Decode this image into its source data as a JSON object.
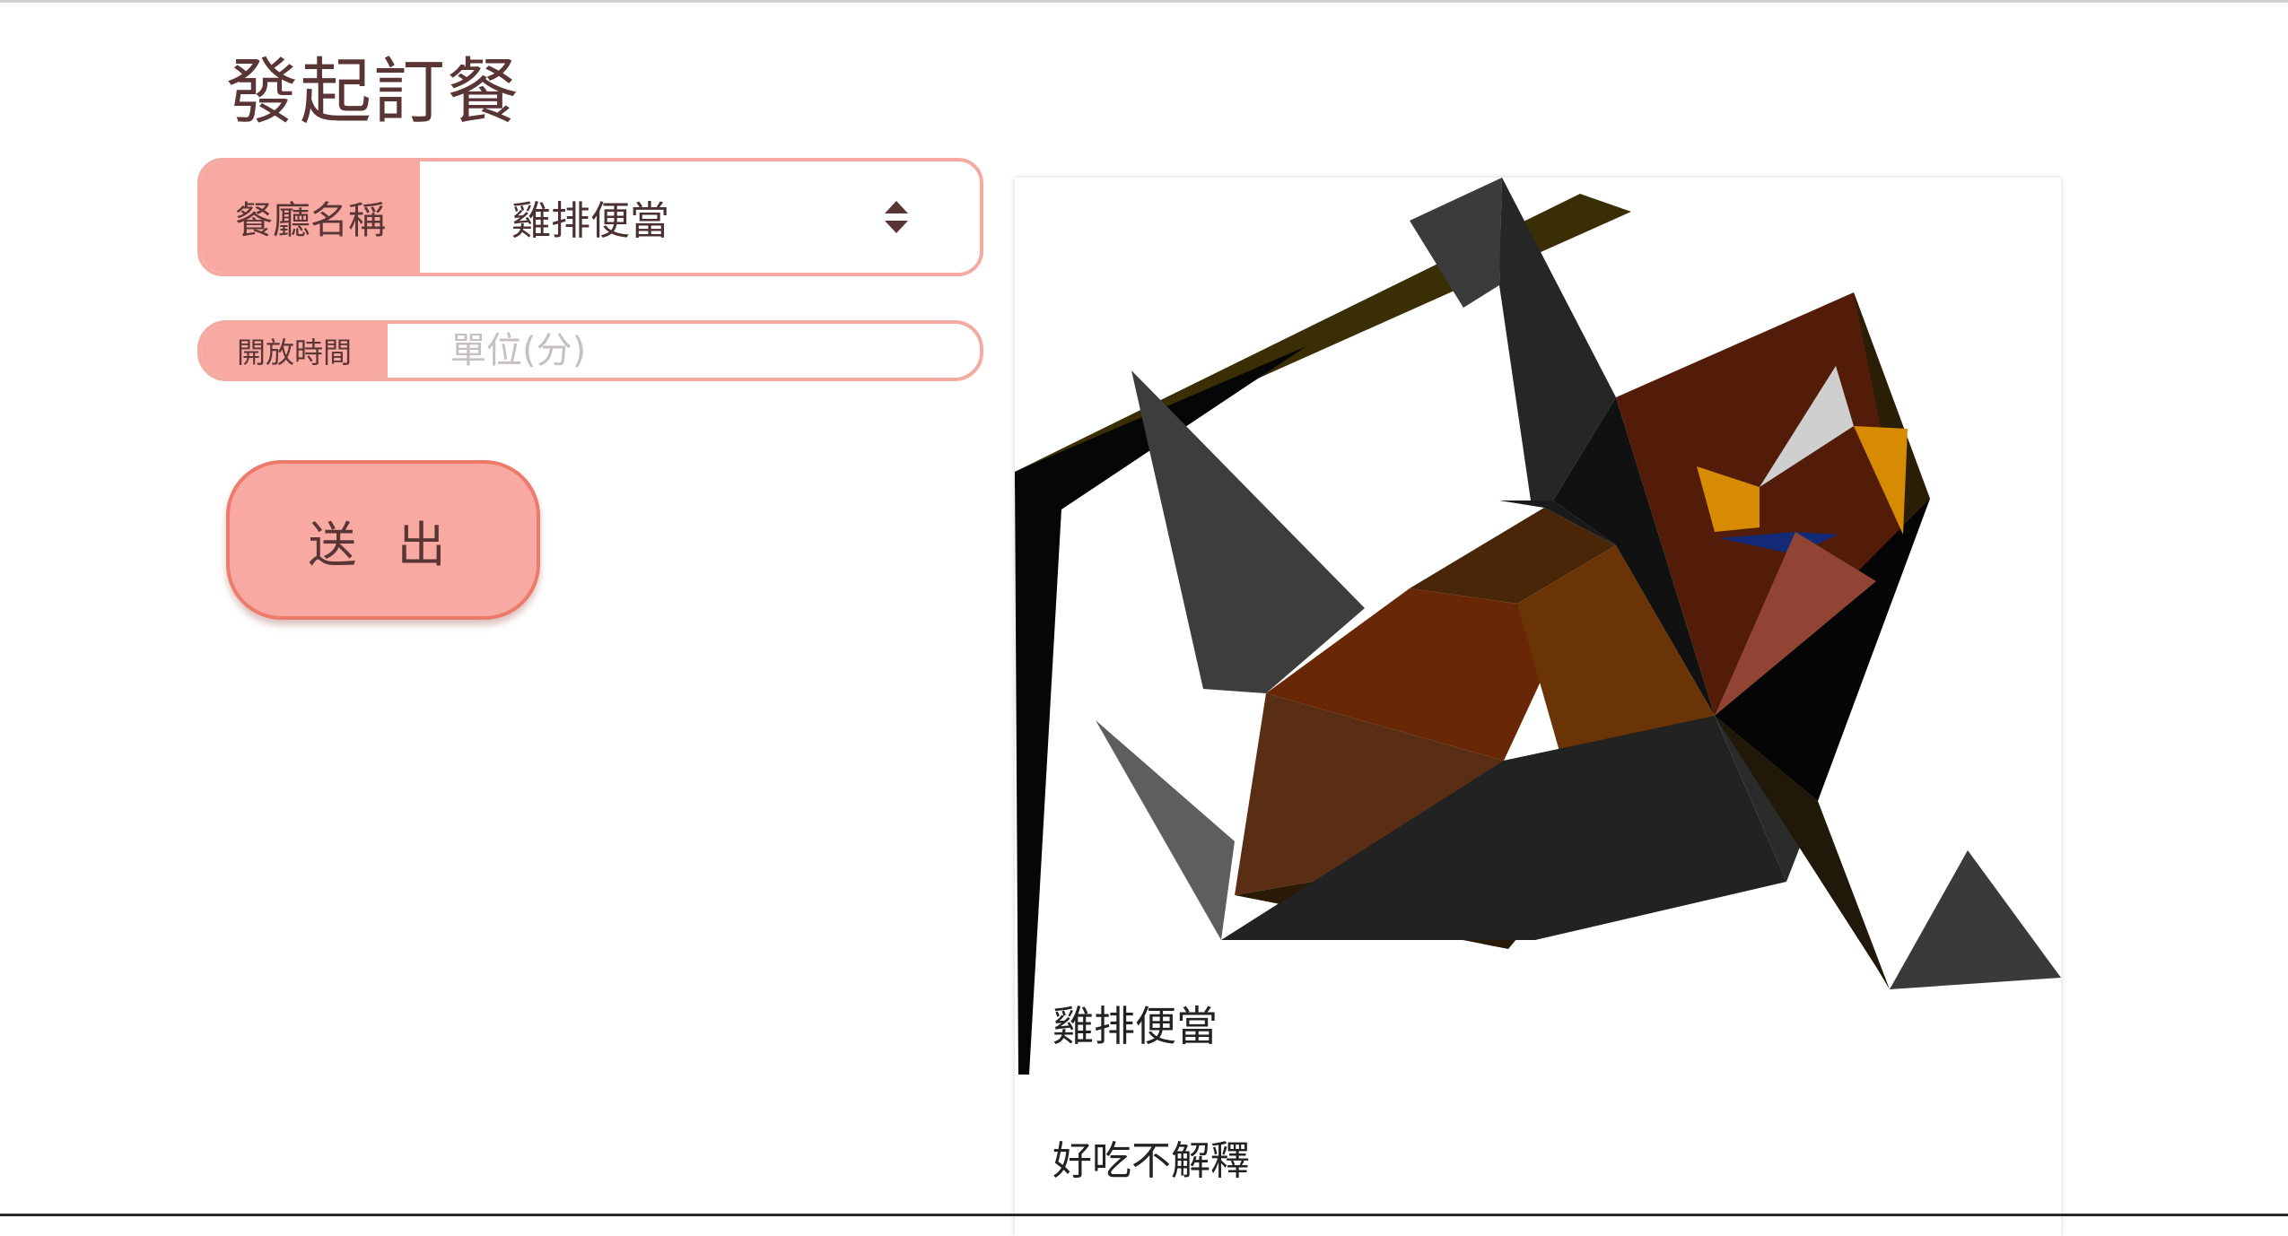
{
  "page": {
    "title": "發起訂餐"
  },
  "form": {
    "restaurant": {
      "label": "餐廳名稱",
      "selected": "雞排便當"
    },
    "open_time": {
      "label": "開放時間",
      "value": "",
      "placeholder": "單位(分)"
    },
    "submit_label": "送 出"
  },
  "preview": {
    "name": "雞排便當",
    "description": "好吃不解釋"
  },
  "icons": {
    "select": "sort-arrows-icon"
  },
  "colors": {
    "accent": "#f8a9a1",
    "border": "#f4aaa2",
    "button_border": "#ee7a6c",
    "text": "#5a3535"
  }
}
